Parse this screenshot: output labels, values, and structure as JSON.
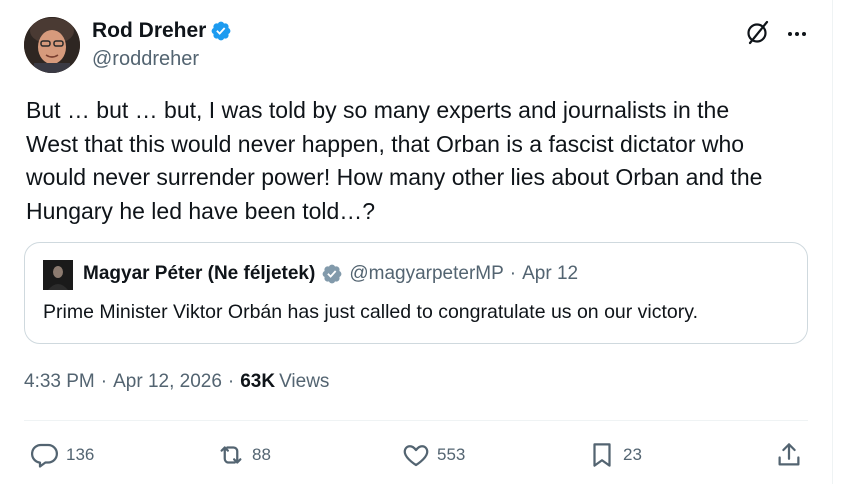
{
  "author": {
    "name": "Rod Dreher",
    "handle": "@roddreher"
  },
  "tweet": {
    "text": "But … but … but, I was told by so many experts and journalists in the\nWest that this would never happen, that Orban is a fascist dictator who\nwould never surrender power! How many other lies about Orban and the\nHungary he led have been told…?"
  },
  "quote": {
    "name": "Magyar Péter (Ne féljetek)",
    "handle": "@magyarpeterMP",
    "separator": "·",
    "date": "Apr 12",
    "text": "Prime Minister Viktor Orbán has just called to congratulate us on our victory."
  },
  "meta": {
    "time": "4:33 PM",
    "separator": "·",
    "date": "Apr 12, 2026",
    "views_count": "63K",
    "views_label": "Views"
  },
  "actions": {
    "replies": "136",
    "reposts": "88",
    "likes": "553",
    "bookmarks": "23"
  },
  "colors": {
    "verified": "#1d9bf0",
    "secondary_text": "#536471",
    "primary_text": "#0f1419",
    "border": "#cfd9de"
  },
  "icons": [
    "verified-badge-icon",
    "grok-icon",
    "more-icon",
    "reply-icon",
    "repost-icon",
    "like-icon",
    "bookmark-icon",
    "share-icon"
  ]
}
